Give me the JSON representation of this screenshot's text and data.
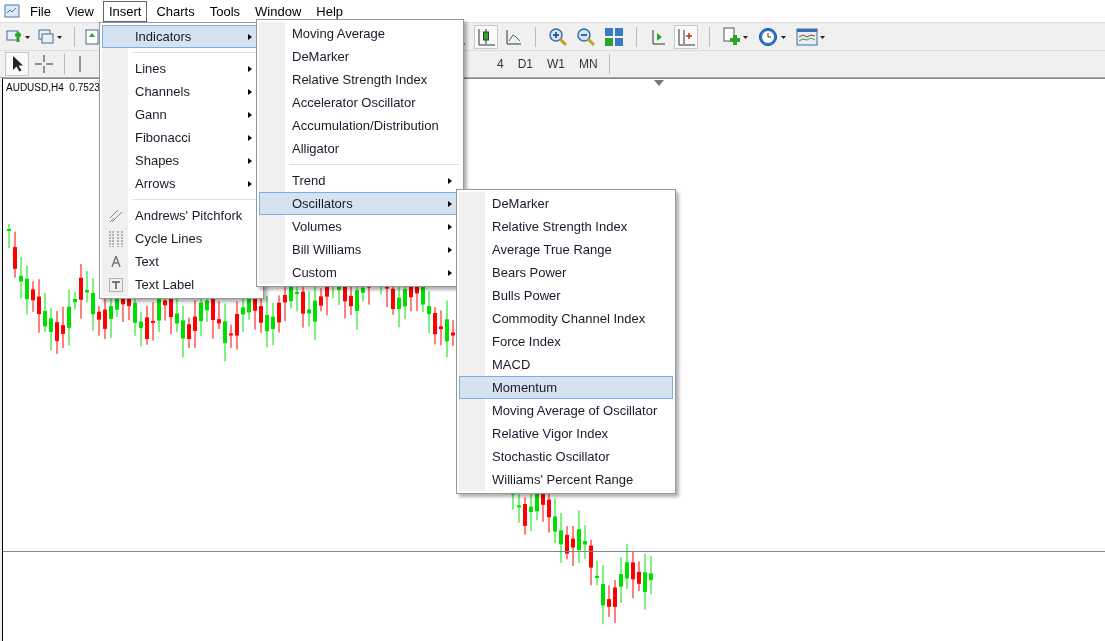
{
  "menubar": {
    "items": [
      {
        "label": "File",
        "selected": false
      },
      {
        "label": "View",
        "selected": false
      },
      {
        "label": "Insert",
        "selected": true
      },
      {
        "label": "Charts",
        "selected": false
      },
      {
        "label": "Tools",
        "selected": false
      },
      {
        "label": "Window",
        "selected": false
      },
      {
        "label": "Help",
        "selected": false
      }
    ]
  },
  "timeframes": [
    "4",
    "D1",
    "W1",
    "MN"
  ],
  "chart": {
    "symbol_label": "AUDUSD,H4  0.7523"
  },
  "insert_menu": {
    "items": [
      {
        "kind": "submenu",
        "label": "Indicators",
        "selected": true
      },
      {
        "kind": "separator"
      },
      {
        "kind": "submenu",
        "label": "Lines",
        "selected": false
      },
      {
        "kind": "submenu",
        "label": "Channels",
        "selected": false
      },
      {
        "kind": "submenu",
        "label": "Gann",
        "selected": false
      },
      {
        "kind": "submenu",
        "label": "Fibonacci",
        "selected": false
      },
      {
        "kind": "submenu",
        "label": "Shapes",
        "selected": false
      },
      {
        "kind": "submenu",
        "label": "Arrows",
        "selected": false
      },
      {
        "kind": "separator"
      },
      {
        "kind": "tool",
        "label": "Andrews' Pitchfork",
        "selected": false
      },
      {
        "kind": "tool",
        "label": "Cycle Lines",
        "selected": false
      },
      {
        "kind": "tool",
        "label": "Text",
        "selected": false
      },
      {
        "kind": "tool",
        "label": "Text Label",
        "selected": false
      }
    ]
  },
  "indicators_menu": {
    "items": [
      {
        "kind": "command",
        "label": "Moving Average",
        "selected": false
      },
      {
        "kind": "command",
        "label": "DeMarker",
        "selected": false
      },
      {
        "kind": "command",
        "label": "Relative Strength Index",
        "selected": false
      },
      {
        "kind": "command",
        "label": "Accelerator Oscillator",
        "selected": false
      },
      {
        "kind": "command",
        "label": "Accumulation/Distribution",
        "selected": false
      },
      {
        "kind": "command",
        "label": "Alligator",
        "selected": false
      },
      {
        "kind": "separator"
      },
      {
        "kind": "submenu",
        "label": "Trend",
        "selected": false
      },
      {
        "kind": "submenu",
        "label": "Oscillators",
        "selected": true
      },
      {
        "kind": "submenu",
        "label": "Volumes",
        "selected": false
      },
      {
        "kind": "submenu",
        "label": "Bill Williams",
        "selected": false
      },
      {
        "kind": "submenu",
        "label": "Custom",
        "selected": false
      }
    ]
  },
  "oscillators_menu": {
    "items": [
      {
        "kind": "command",
        "label": "DeMarker",
        "selected": false
      },
      {
        "kind": "command",
        "label": "Relative Strength Index",
        "selected": false
      },
      {
        "kind": "command",
        "label": "Average True Range",
        "selected": false
      },
      {
        "kind": "command",
        "label": "Bears Power",
        "selected": false
      },
      {
        "kind": "command",
        "label": "Bulls Power",
        "selected": false
      },
      {
        "kind": "command",
        "label": "Commodity Channel Index",
        "selected": false
      },
      {
        "kind": "command",
        "label": "Force Index",
        "selected": false
      },
      {
        "kind": "command",
        "label": "MACD",
        "selected": false
      },
      {
        "kind": "command",
        "label": "Momentum",
        "selected": true
      },
      {
        "kind": "command",
        "label": "Moving Average of Oscillator",
        "selected": false
      },
      {
        "kind": "command",
        "label": "Relative Vigor Index",
        "selected": false
      },
      {
        "kind": "command",
        "label": "Stochastic Oscillator",
        "selected": false
      },
      {
        "kind": "command",
        "label": "Williams' Percent Range",
        "selected": false
      }
    ]
  }
}
